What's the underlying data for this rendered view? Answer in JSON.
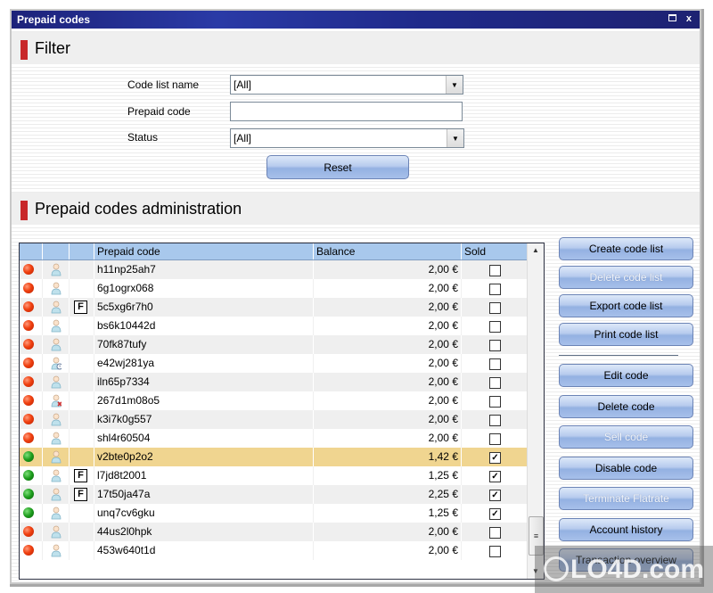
{
  "window": {
    "title": "Prepaid codes",
    "maximize_icon": "maximize-icon",
    "close_icon": "close-icon",
    "close_glyph": "x"
  },
  "filter": {
    "heading": "Filter",
    "code_list_name": {
      "label": "Code list name",
      "value": "[All]"
    },
    "prepaid_code": {
      "label": "Prepaid code",
      "value": ""
    },
    "status": {
      "label": "Status",
      "value": "[All]"
    },
    "reset_label": "Reset"
  },
  "admin": {
    "heading": "Prepaid codes administration",
    "columns": [
      "",
      "",
      "",
      "Prepaid code",
      "Balance",
      "Sold"
    ],
    "rows": [
      {
        "status": "red",
        "user_icon": "user-icon",
        "flag": "",
        "code": "h11np25ah7",
        "balance": "2,00 €",
        "sold": false
      },
      {
        "status": "red",
        "user_icon": "user-icon",
        "flag": "",
        "code": "6g1ogrx068",
        "balance": "2,00 €",
        "sold": false
      },
      {
        "status": "red",
        "user_icon": "user-icon",
        "flag": "F",
        "code": "5c5xg6r7h0",
        "balance": "2,00 €",
        "sold": false
      },
      {
        "status": "red",
        "user_icon": "user-icon",
        "flag": "",
        "code": "bs6k10442d",
        "balance": "2,00 €",
        "sold": false
      },
      {
        "status": "red",
        "user_icon": "user-icon",
        "flag": "",
        "code": "70fk87tufy",
        "balance": "2,00 €",
        "sold": false
      },
      {
        "status": "red",
        "user_icon": "user-clock-icon",
        "flag": "",
        "code": "e42wj281ya",
        "balance": "2,00 €",
        "sold": false
      },
      {
        "status": "red",
        "user_icon": "user-icon",
        "flag": "",
        "code": "iln65p7334",
        "balance": "2,00 €",
        "sold": false
      },
      {
        "status": "red",
        "user_icon": "user-blocked-icon",
        "flag": "",
        "code": "267d1m08o5",
        "balance": "2,00 €",
        "sold": false
      },
      {
        "status": "red",
        "user_icon": "user-icon",
        "flag": "",
        "code": "k3i7k0g557",
        "balance": "2,00 €",
        "sold": false
      },
      {
        "status": "red",
        "user_icon": "user-icon",
        "flag": "",
        "code": "shl4r60504",
        "balance": "2,00 €",
        "sold": false
      },
      {
        "status": "green",
        "user_icon": "user-icon",
        "flag": "",
        "code": "v2bte0p2o2",
        "balance": "1,42 €",
        "sold": true,
        "selected": true
      },
      {
        "status": "green",
        "user_icon": "user-icon",
        "flag": "F",
        "code": "l7jd8t2001",
        "balance": "1,25 €",
        "sold": true
      },
      {
        "status": "green",
        "user_icon": "user-icon",
        "flag": "F",
        "code": "17t50ja47a",
        "balance": "2,25 €",
        "sold": true
      },
      {
        "status": "green",
        "user_icon": "user-icon",
        "flag": "",
        "code": "unq7cv6gku",
        "balance": "1,25 €",
        "sold": true
      },
      {
        "status": "red",
        "user_icon": "user-icon",
        "flag": "",
        "code": "44us2l0hpk",
        "balance": "2,00 €",
        "sold": false
      },
      {
        "status": "red",
        "user_icon": "user-icon",
        "flag": "",
        "code": "453w640t1d",
        "balance": "2,00 €",
        "sold": false
      }
    ],
    "buttons_group1": [
      {
        "label": "Create code list",
        "enabled": true
      },
      {
        "label": "Delete code list",
        "enabled": false
      },
      {
        "label": "Export code list",
        "enabled": true
      },
      {
        "label": "Print code list",
        "enabled": true
      }
    ],
    "buttons_group2": [
      {
        "label": "Edit code",
        "enabled": true
      },
      {
        "label": "Delete code",
        "enabled": true
      },
      {
        "label": "Sell code",
        "enabled": false
      },
      {
        "label": "Disable code",
        "enabled": true
      },
      {
        "label": "Terminate Flatrate",
        "enabled": false
      },
      {
        "label": "Account history",
        "enabled": true
      },
      {
        "label": "Transaction overview",
        "enabled": true
      }
    ]
  },
  "colors": {
    "titlebar": "#1d237a",
    "section_marker": "#c8282a",
    "header_row": "#a8c8ec",
    "selected_row": "#f0d590",
    "status_active": "#1c9c1c",
    "status_inactive": "#f04010"
  },
  "watermark": {
    "text": "LO4D.com"
  }
}
